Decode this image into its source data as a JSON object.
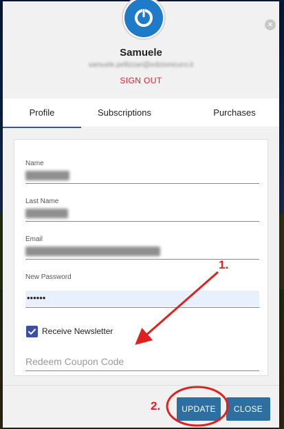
{
  "modal": {
    "user_name": "Samuele",
    "user_email": "samuele.pellizzari@edizionicurci.it",
    "sign_out_label": "SIGN OUT",
    "close_glyph": "×",
    "avatar_icon": "power-icon"
  },
  "tabs": [
    {
      "label": "Profile",
      "active": true
    },
    {
      "label": "Subscriptions",
      "active": false
    },
    {
      "label": "Purchases",
      "active": false
    }
  ],
  "form": {
    "name_label": "Name",
    "last_name_label": "Last Name",
    "email_label": "Email",
    "new_password_label": "New Password",
    "password_value": "••••••",
    "newsletter_label": "Receive Newsletter",
    "newsletter_checked": true,
    "coupon_placeholder": "Redeem Coupon Code"
  },
  "footer": {
    "update_label": "UPDATE",
    "close_label": "CLOSE"
  },
  "annotations": {
    "step1": "1.",
    "step2": "2."
  },
  "colors": {
    "accent": "#3c4fa8",
    "button": "#2f6fa0",
    "sign_out": "#d9232e",
    "annotation": "#e02020",
    "avatar": "#1f7ac7"
  }
}
